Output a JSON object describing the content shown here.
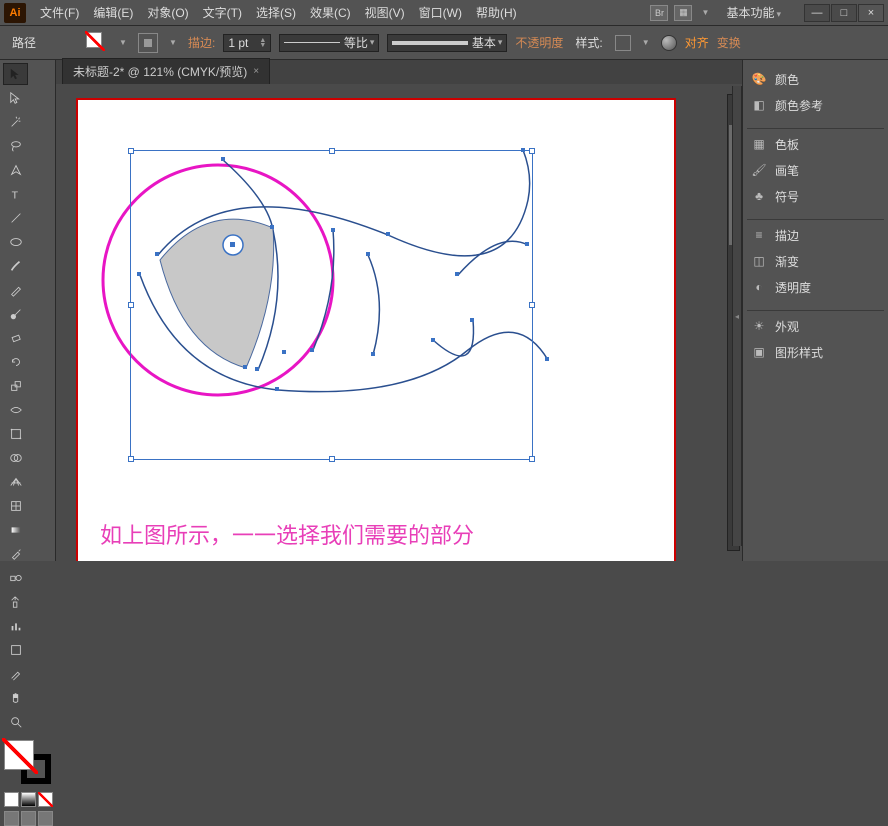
{
  "menubar": {
    "logo": "Ai",
    "items": [
      {
        "label": "文件(F)"
      },
      {
        "label": "编辑(E)"
      },
      {
        "label": "对象(O)"
      },
      {
        "label": "文字(T)"
      },
      {
        "label": "选择(S)"
      },
      {
        "label": "效果(C)"
      },
      {
        "label": "视图(V)"
      },
      {
        "label": "窗口(W)"
      },
      {
        "label": "帮助(H)"
      }
    ],
    "br": "Br",
    "basics": "基本功能",
    "win": {
      "min": "—",
      "max": "□",
      "close": "×"
    }
  },
  "ctrlbar": {
    "path_label": "路径",
    "stroke_label": "描边:",
    "stroke_pt": "1 pt",
    "uniform": "等比",
    "basic": "基本",
    "opacity": "不透明度",
    "style": "样式:",
    "align": "对齐",
    "transform": "变换"
  },
  "doc": {
    "tab": "未标题-2* @ 121% (CMYK/预览)",
    "caption": "如上图所示，一一选择我们需要的部分"
  },
  "panels": {
    "items": [
      {
        "icon": "palette",
        "label": "颜色"
      },
      {
        "icon": "guide",
        "label": "颜色参考"
      },
      {
        "sep": true
      },
      {
        "icon": "swatches",
        "label": "色板"
      },
      {
        "icon": "brushes",
        "label": "画笔"
      },
      {
        "icon": "symbols",
        "label": "符号"
      },
      {
        "sep": true
      },
      {
        "icon": "stroke",
        "label": "描边"
      },
      {
        "icon": "gradient",
        "label": "渐变"
      },
      {
        "icon": "transparency",
        "label": "透明度"
      },
      {
        "sep": true
      },
      {
        "icon": "appearance",
        "label": "外观"
      },
      {
        "icon": "graphic",
        "label": "图形样式"
      }
    ]
  }
}
